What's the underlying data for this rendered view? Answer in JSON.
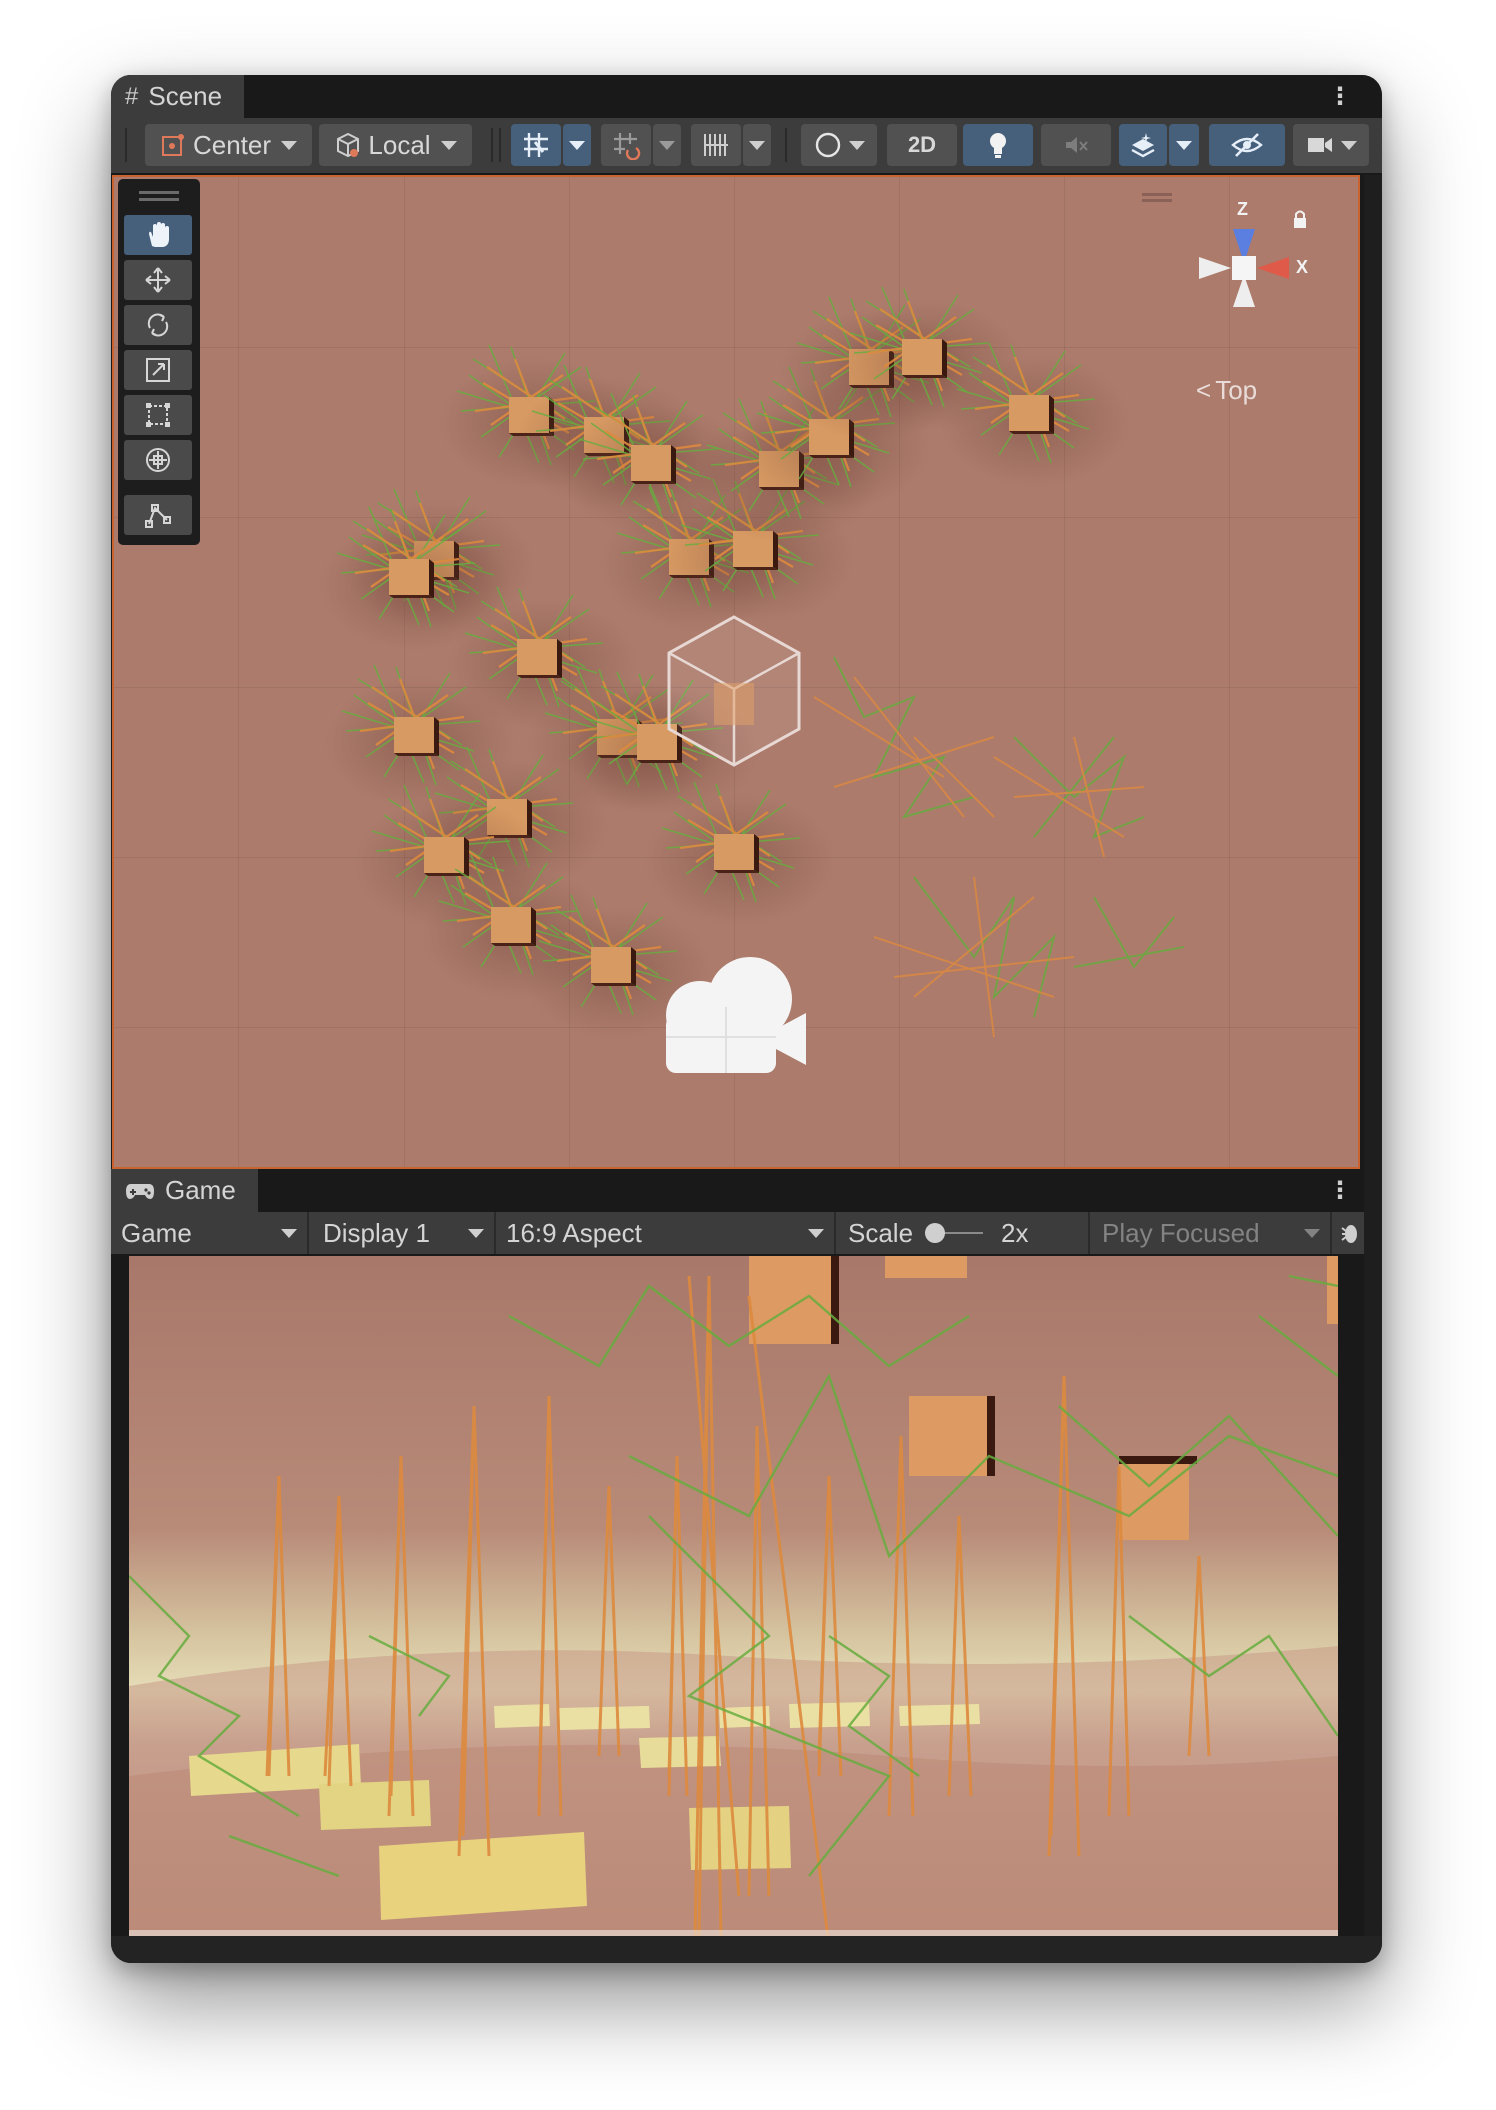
{
  "scene_panel": {
    "tab_label": "Scene",
    "tab_icon": "hash-grid-icon",
    "toolbar": {
      "pivot_mode": "Center",
      "pivot_rotation": "Local",
      "mode_2d": "2D"
    },
    "gizmo": {
      "axis_z": "Z",
      "axis_x": "X",
      "view_label": "Top"
    },
    "tools": [
      "hand",
      "move",
      "rotate",
      "scale",
      "rect",
      "transform",
      "custom"
    ],
    "selected_tool": "hand"
  },
  "game_panel": {
    "tab_label": "Game",
    "tab_icon": "gamepad-icon",
    "toolbar": {
      "view": "Game",
      "display": "Display 1",
      "aspect": "16:9 Aspect",
      "scale_label": "Scale",
      "scale_value": "2x",
      "play_mode": "Play Focused"
    }
  },
  "colors": {
    "scene_background": "#ac7b6c",
    "scene_border": "#c9632f",
    "toggle_active": "#46607c",
    "stalk_orange": "#d9853a",
    "stalk_green": "#5fb040"
  }
}
